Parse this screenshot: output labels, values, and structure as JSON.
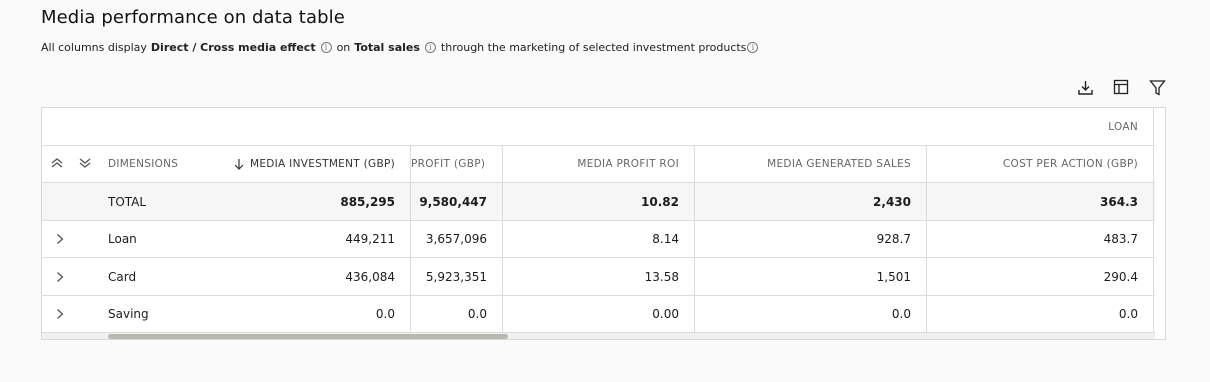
{
  "title": "Media performance on data table",
  "subtitle": {
    "prefix": "All columns display",
    "effect": "Direct / Cross media effect",
    "on": "on",
    "metric": "Total sales",
    "suffix": "through the marketing of selected investment products"
  },
  "toolbar": {
    "icons": [
      "download-icon",
      "columns-icon",
      "filter-icon"
    ]
  },
  "table": {
    "group_label": "LOAN",
    "headers": {
      "dimensions": "DIMENSIONS",
      "investment": "MEDIA INVESTMENT (GBP)",
      "profit": "PROFIT (GBP)",
      "roi": "MEDIA PROFIT ROI",
      "generated": "MEDIA GENERATED SALES",
      "cpa": "COST PER ACTION (GBP)"
    },
    "total": {
      "label": "TOTAL",
      "investment": "885,295",
      "profit": "9,580,447",
      "roi": "10.82",
      "generated": "2,430",
      "cpa": "364.3"
    },
    "rows": [
      {
        "label": "Loan",
        "investment": "449,211",
        "profit": "3,657,096",
        "roi": "8.14",
        "generated": "928.7",
        "cpa": "483.7"
      },
      {
        "label": "Card",
        "investment": "436,084",
        "profit": "5,923,351",
        "roi": "13.58",
        "generated": "1,501",
        "cpa": "290.4"
      },
      {
        "label": "Saving",
        "investment": "0.0",
        "profit": "0.0",
        "roi": "0.00",
        "generated": "0.0",
        "cpa": "0.0"
      }
    ]
  },
  "colors": {
    "border": "#dcdcdc",
    "header_text": "#666666",
    "scroll_thumb": "#b8b8b0"
  }
}
